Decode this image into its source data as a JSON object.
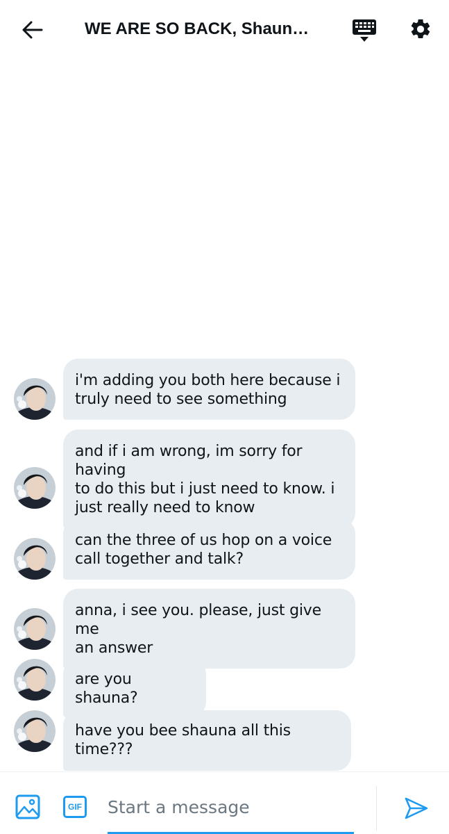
{
  "header": {
    "title": "WE ARE SO BACK, Shaun…",
    "back_icon": "arrow-left-icon",
    "keyboard_icon": "keyboard-icon",
    "settings_icon": "gear-icon"
  },
  "messages": [
    {
      "lines": [
        "i'm adding you both here because i",
        "truly need to see something"
      ]
    },
    {
      "lines": [
        "and if i am wrong, im sorry for having",
        "to do this but i just need to know. i",
        "just really need to know"
      ]
    },
    {
      "lines": [
        "can the three of us hop on a voice",
        "call together and talk?"
      ]
    },
    {
      "lines": [
        "anna, i see you. please, just give me",
        "an answer"
      ]
    },
    {
      "lines": [
        "are you shauna?"
      ]
    },
    {
      "lines": [
        "have you bee shauna all this time???"
      ]
    }
  ],
  "composer": {
    "placeholder": "Start a message",
    "value": "",
    "media_icon": "image-icon",
    "gif_label": "GIF",
    "send_icon": "send-icon"
  },
  "colors": {
    "accent": "#1d9bf0",
    "bubble": "#e8edf1",
    "text": "#0f1419"
  }
}
